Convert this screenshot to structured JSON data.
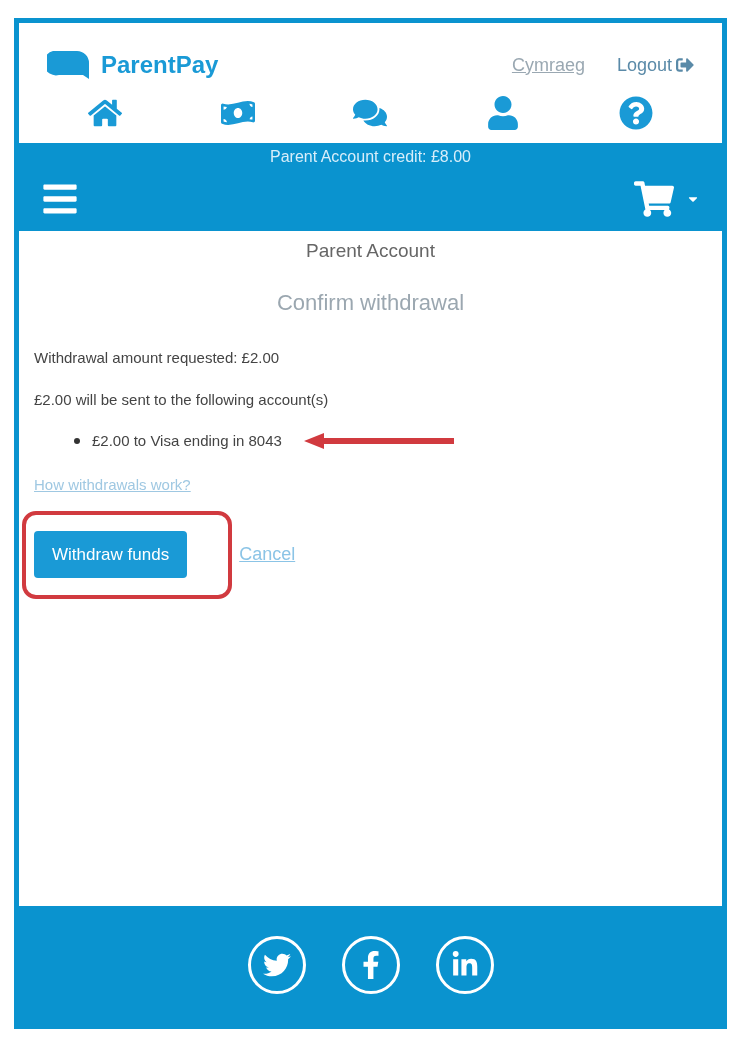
{
  "header": {
    "brand": "ParentPay",
    "language_link": "Cymraeg",
    "logout": "Logout"
  },
  "credit_bar": {
    "text": "Parent Account credit: £8.00"
  },
  "page": {
    "title": "Parent Account",
    "subtitle": "Confirm withdrawal",
    "lines": [
      "Withdrawal amount requested: £2.00",
      "£2.00 will be sent to the following account(s)"
    ],
    "accounts": [
      "£2.00 to Visa ending in 8043"
    ],
    "help_link": "How withdrawals work?",
    "primary_button": "Withdraw funds",
    "cancel_link": "Cancel"
  }
}
